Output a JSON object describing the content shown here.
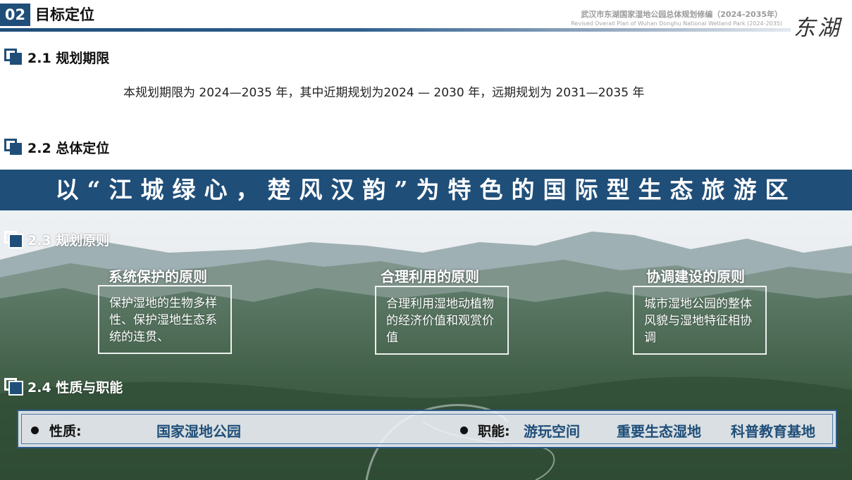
{
  "header": {
    "section_number": "02",
    "section_title": "目标定位",
    "doc_title_cn": "武汉市东湖国家湿地公园总体规划修编（2024-2035年）",
    "doc_title_en": "Revised Overall Plan of Wuhan Donghu National Wetland Park (2024-2035)",
    "logo_text": "东湖"
  },
  "sections": {
    "s21": {
      "label": "2.1 规划期限"
    },
    "s22": {
      "label": "2.2 总体定位"
    },
    "s23": {
      "label": "2.3 规划原则"
    },
    "s24": {
      "label": "2.4 性质与职能"
    }
  },
  "period_text": "本规划期限为 2024—2035 年，其中近期规划为2024 — 2030 年，远期规划为 2031—2035 年",
  "positioning_banner": "以“江城绿心，楚风汉韵”为特色的国际型生态旅游区",
  "principles": [
    {
      "title": "系统保护的原则",
      "text": " 保护湿地的生物多样性、保护湿地生态系统的连贯、"
    },
    {
      "title": "合理利用的原则",
      "text": "合理利用湿地动植物的经济价值和观赏价值"
    },
    {
      "title": "协调建设的原则",
      "text": "城市湿地公园的整体风貌与湿地特征相协调"
    }
  ],
  "nature": {
    "nature_label": "性质:",
    "nature_value": "国家湿地公园",
    "function_label": "职能:",
    "functions": [
      "游玩空间",
      "重要生态湿地",
      "科普教育基地"
    ]
  },
  "colors": {
    "primary_blue": "#1f4e79",
    "value_blue": "#1f4e79"
  }
}
